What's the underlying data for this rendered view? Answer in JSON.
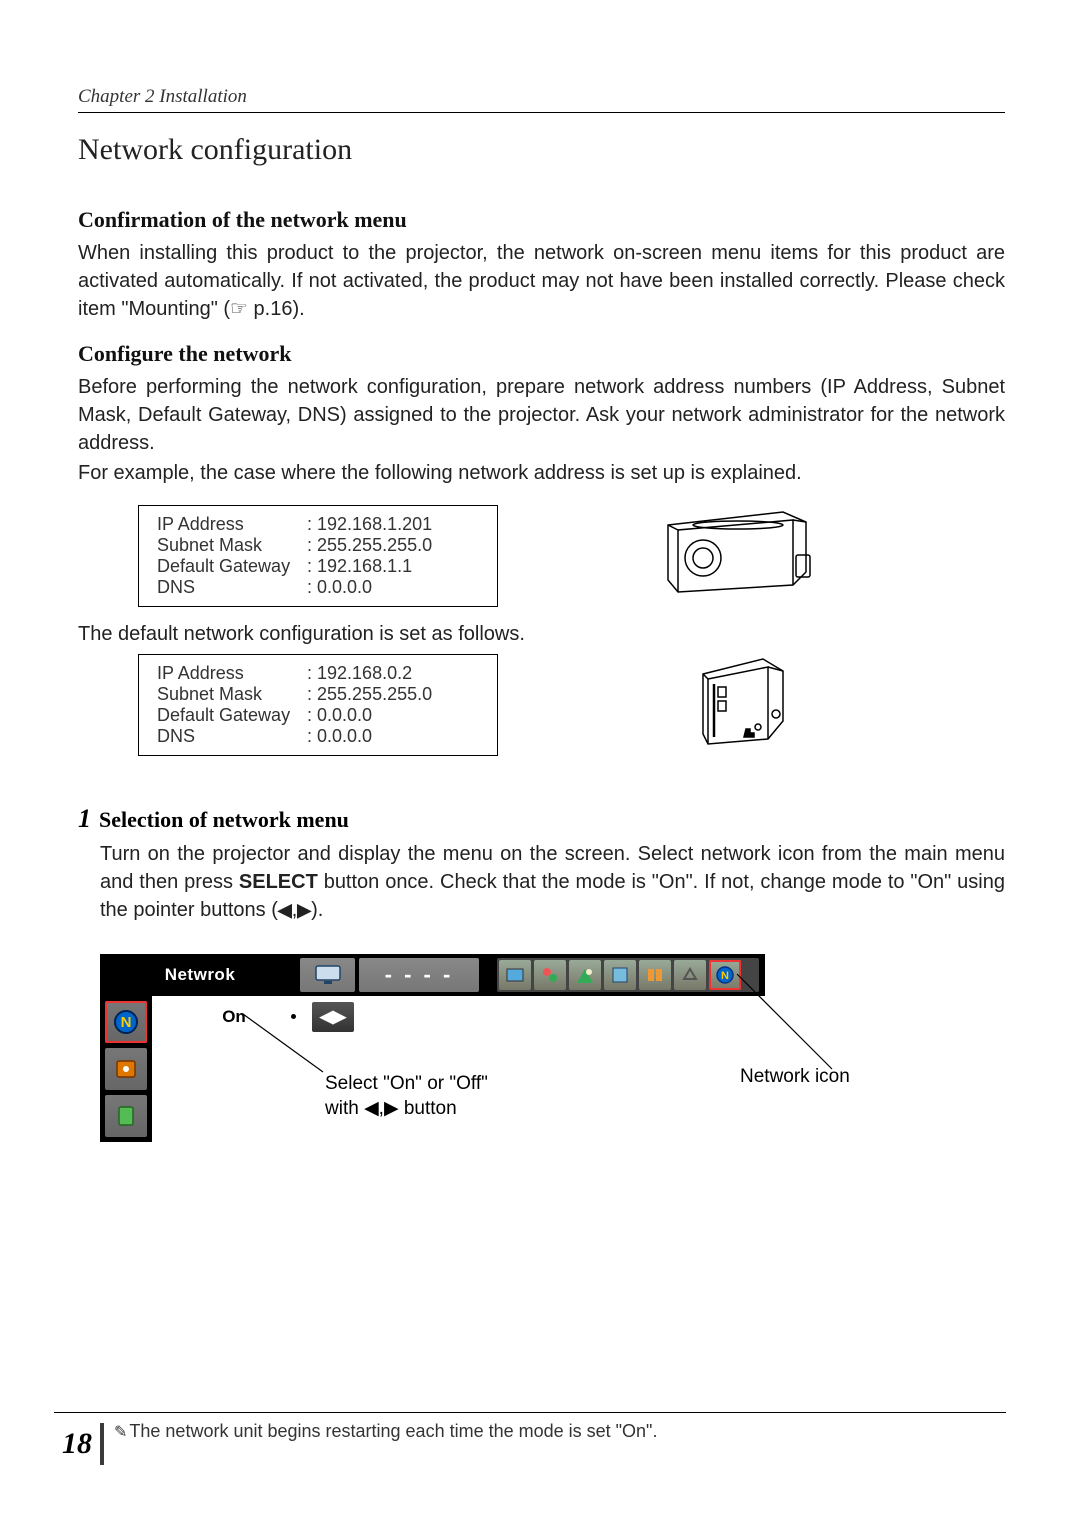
{
  "chapter": "Chapter 2 Installation",
  "section_title": "Network configuration",
  "sub1_title": "Confirmation of the network menu",
  "sub1_body": "When installing this product to the projector, the network on-screen menu items for this product are activated automatically. If not activated, the product may not have been installed correctly. Please check item \"Mounting\" (☞ p.16).",
  "sub2_title": "Configure the network",
  "sub2_body1": "Before performing the network configuration, prepare network address numbers (IP Address, Subnet Mask, Default Gateway, DNS) assigned to the projector. Ask your network administrator for the network address.",
  "sub2_body2": "For example, the case where the following network address is set up is explained.",
  "example_config": {
    "ip_label": "IP Address",
    "ip_val": "192.168.1.201",
    "mask_label": "Subnet Mask",
    "mask_val": "255.255.255.0",
    "gw_label": "Default Gateway",
    "gw_val": "192.168.1.1",
    "dns_label": "DNS",
    "dns_val": "0.0.0.0"
  },
  "default_text": "The default network configuration is set as follows.",
  "default_config": {
    "ip_label": "IP Address",
    "ip_val": "192.168.0.2",
    "mask_label": "Subnet Mask",
    "mask_val": "255.255.255.0",
    "gw_label": "Default Gateway",
    "gw_val": "0.0.0.0",
    "dns_label": "DNS",
    "dns_val": "0.0.0.0"
  },
  "step1_num": "1",
  "step1_title": "Selection of network menu",
  "step1_body_a": "Turn on the projector and display the menu on the screen. Select network icon from the main menu and then press ",
  "step1_body_select": "SELECT",
  "step1_body_b": " button once. Check that the mode is \"On\". If not, change mode to \"On\" using the pointer buttons (",
  "step1_body_c": ").",
  "osd": {
    "title": "Netwrok",
    "dashes": "- - - -",
    "on_label": "On"
  },
  "annot_onoff_line1": "Select \"On\" or \"Off\"",
  "annot_onoff_line2": "with ◀,▶ button",
  "annot_network_icon": "Network icon",
  "page_number": "18",
  "footnote": "The network unit begins restarting each time the mode is set \"On\"."
}
